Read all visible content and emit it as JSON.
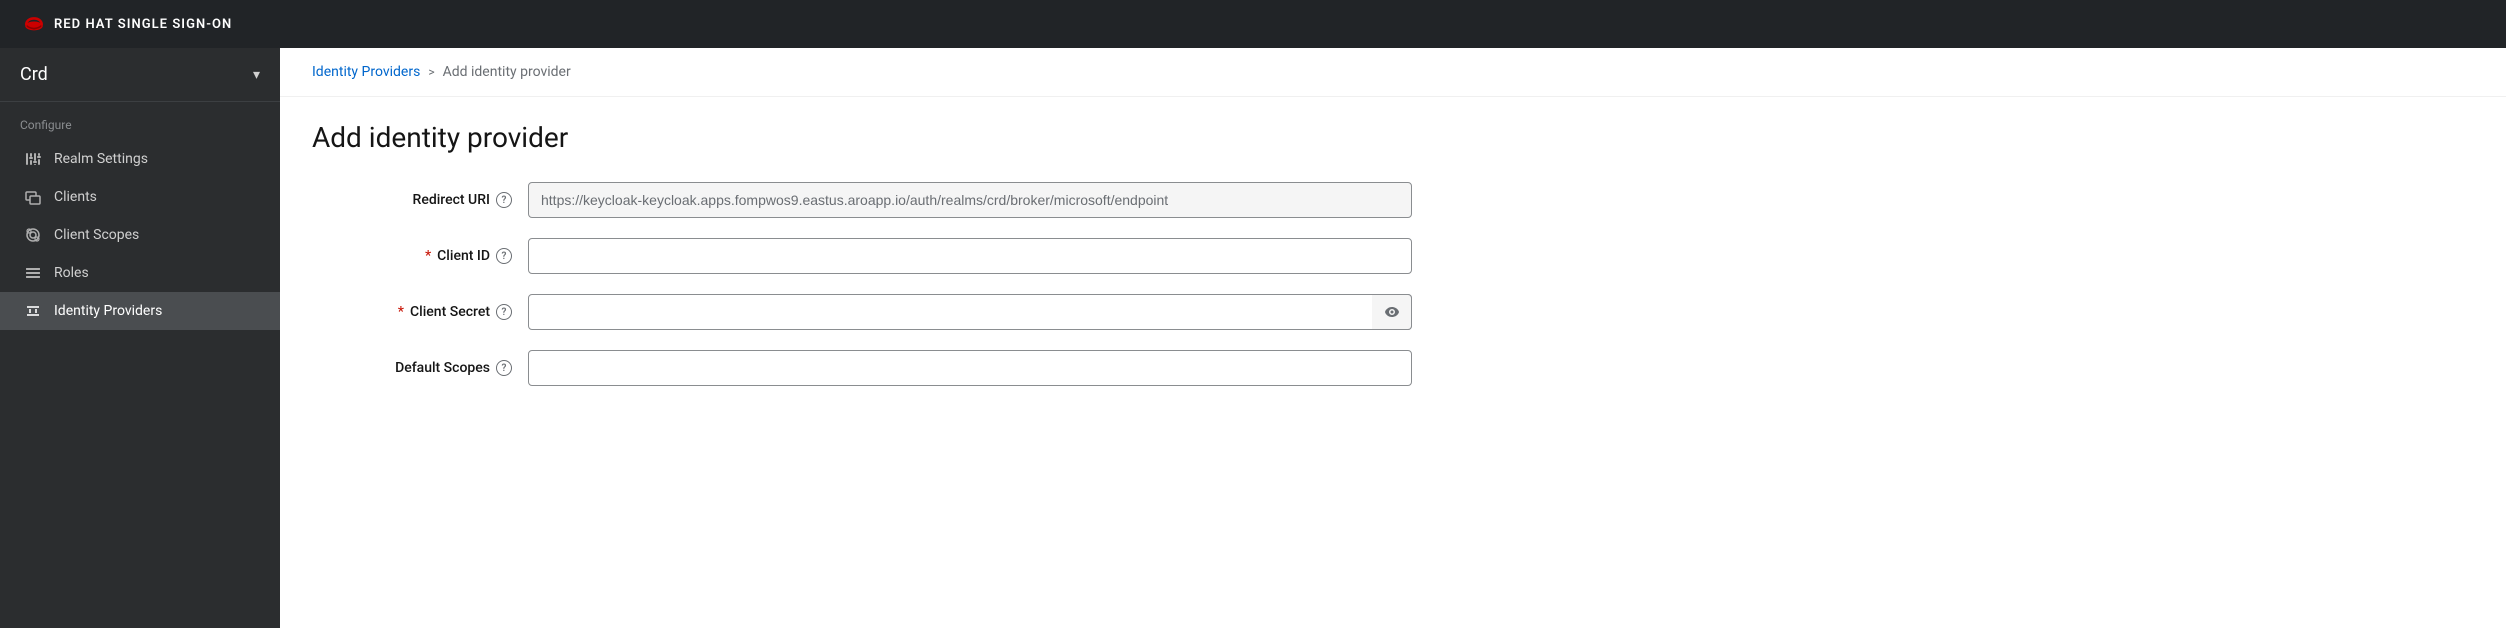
{
  "topNav": {
    "title": "RED HAT SINGLE SIGN-ON"
  },
  "sidebar": {
    "realm": {
      "name": "Crd"
    },
    "configure": {
      "label": "Configure",
      "items": [
        {
          "id": "realm-settings",
          "label": "Realm Settings",
          "icon": "sliders-icon"
        },
        {
          "id": "clients",
          "label": "Clients",
          "icon": "clients-icon"
        },
        {
          "id": "client-scopes",
          "label": "Client Scopes",
          "icon": "scopes-icon"
        },
        {
          "id": "roles",
          "label": "Roles",
          "icon": "roles-icon"
        },
        {
          "id": "identity-providers",
          "label": "Identity Providers",
          "icon": "identity-icon",
          "active": true
        }
      ]
    }
  },
  "breadcrumb": {
    "link": "Identity Providers",
    "separator": ">",
    "current": "Add identity provider"
  },
  "page": {
    "title": "Add identity provider"
  },
  "form": {
    "redirectUri": {
      "label": "Redirect URI",
      "value": "https://keycloak-keycloak.apps.fompwos9.eastus.aroapp.io/auth/realms/crd/broker/microsoft/endpoint",
      "placeholder": ""
    },
    "clientId": {
      "label": "Client ID",
      "required": true,
      "placeholder": ""
    },
    "clientSecret": {
      "label": "Client Secret",
      "required": true,
      "placeholder": "",
      "eyeLabel": "show"
    },
    "defaultScopes": {
      "label": "Default Scopes",
      "placeholder": ""
    }
  }
}
